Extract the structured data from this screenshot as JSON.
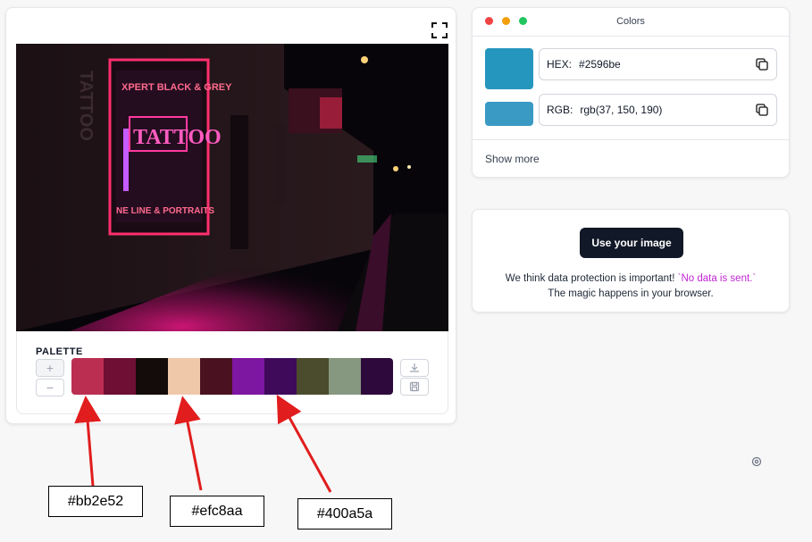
{
  "palette": {
    "title": "PALETTE",
    "add_label": "+",
    "remove_label": "−",
    "swatches": [
      "#bb2e52",
      "#6e0f33",
      "#140b0b",
      "#efc8aa",
      "#4a1220",
      "#7d16a0",
      "#400a5a",
      "#4b4b2e",
      "#869880",
      "#2e0a3c"
    ]
  },
  "colors_panel": {
    "title": "Colors",
    "window_dots": [
      "#ef4444",
      "#f59e0b",
      "#22c55e"
    ],
    "hex": {
      "label": "HEX:",
      "value": "#2596be",
      "swatch": "#2596be"
    },
    "rgb": {
      "label": "RGB:",
      "value": "rgb(37, 150, 190)",
      "swatch": "#3a9ac4"
    },
    "show_more": "Show more"
  },
  "use_image": {
    "button": "Use your image",
    "privacy_line1": "We think data protection is important! ",
    "privacy_highlight": "`No data is sent.`",
    "privacy_line2": "The magic happens in your browser."
  },
  "annotations": [
    {
      "text": "#bb2e52"
    },
    {
      "text": "#efc8aa"
    },
    {
      "text": "#400a5a"
    }
  ],
  "icons": [
    "fullscreen-icon",
    "copy-icon",
    "download-icon",
    "save-icon",
    "gear-icon"
  ]
}
